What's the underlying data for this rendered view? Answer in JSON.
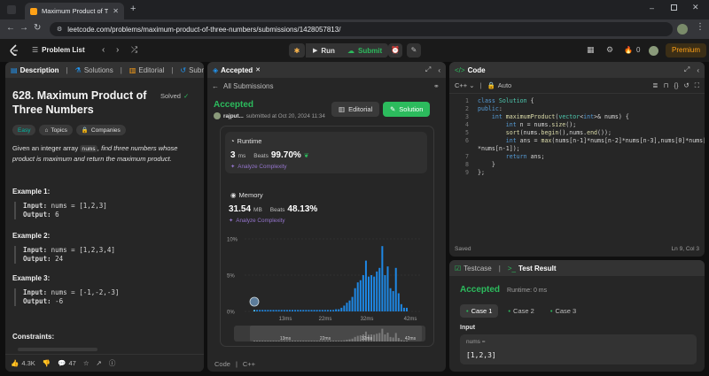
{
  "browser": {
    "tab_title": "Maximum Product of Three Nu",
    "url": "leetcode.com/problems/maximum-product-of-three-numbers/submissions/1428057813/"
  },
  "header": {
    "problem_list_label": "Problem List",
    "run_label": "Run",
    "submit_label": "Submit",
    "streak_count": "0",
    "premium_label": "Premium"
  },
  "left": {
    "tabs": [
      "Description",
      "Solutions",
      "Editorial",
      "Submissions"
    ],
    "title": "628. Maximum Product of Three Numbers",
    "solved_label": "Solved",
    "difficulty": "Easy",
    "topics_label": "Topics",
    "companies_label": "Companies",
    "desc_pre": "Given an integer array ",
    "desc_code": "nums",
    "desc_post": ", find three numbers whose product is maximum and return the maximum product.",
    "examples": [
      {
        "title": "Example 1:",
        "input": "nums = [1,2,3]",
        "output": "6"
      },
      {
        "title": "Example 2:",
        "input": "nums = [1,2,3,4]",
        "output": "24"
      },
      {
        "title": "Example 3:",
        "input": "nums = [-1,-2,-3]",
        "output": "-6"
      }
    ],
    "input_label": "Input:",
    "output_label": "Output:",
    "constraints_label": "Constraints:",
    "likes": "4.3K",
    "comments": "47"
  },
  "mid": {
    "tab_label": "Accepted",
    "back_label": "All Submissions",
    "status": "Accepted",
    "user": "rajput...",
    "submitted_text": "submitted at Oct 20, 2024 11:34",
    "editorial_label": "Editorial",
    "solution_label": "Solution",
    "runtime": {
      "title": "Runtime",
      "value": "3",
      "unit": "ms",
      "beats_label": "Beats",
      "beats": "99.70%",
      "analyze": "Analyze Complexity"
    },
    "memory": {
      "title": "Memory",
      "value": "31.54",
      "unit": "MB",
      "beats_label": "Beats",
      "beats": "48.13%",
      "analyze": "Analyze Complexity"
    },
    "footer_lang_label": "Code",
    "footer_lang": "C++"
  },
  "chart_data": {
    "type": "bar",
    "y_ticks": [
      "10%",
      "5%",
      "0%"
    ],
    "x_ticks": [
      "13ms",
      "22ms",
      "32ms",
      "42ms"
    ],
    "mini_x_ticks": [
      "13ms",
      "22ms",
      "32ms",
      "42ms"
    ],
    "ylim": [
      0,
      10
    ],
    "values": [
      0.2,
      0.2,
      0.2,
      0.2,
      0.2,
      0.2,
      0.2,
      0.2,
      0.2,
      0.2,
      0.2,
      0.2,
      0.2,
      0.2,
      0.2,
      0.2,
      0.2,
      0.2,
      0.2,
      0.2,
      0.2,
      0.2,
      0.2,
      0.2,
      0.2,
      0.2,
      0.2,
      0.2,
      0.2,
      0.2,
      0.3,
      0.3,
      0.5,
      0.8,
      1.2,
      1.5,
      2.0,
      3.2,
      4.0,
      4.3,
      5.0,
      7.0,
      4.8,
      5.0,
      4.8,
      5.5,
      6.0,
      9.0,
      5.0,
      6.2,
      3.2,
      2.8,
      6.0,
      2.5,
      1.0,
      0.5,
      0.5
    ],
    "highlight_index": 0,
    "colors": {
      "bar": "#1e88e5",
      "highlight": "#4fc3f7"
    }
  },
  "code": {
    "tab_label": "Code",
    "lang": "C++",
    "mode": "Auto",
    "lines": [
      {
        "n": "1",
        "t": "class Solution {"
      },
      {
        "n": "2",
        "t": "public:"
      },
      {
        "n": "3",
        "t": "    int maximumProduct(vector<int>& nums) {"
      },
      {
        "n": "4",
        "t": "        int n = nums.size();"
      },
      {
        "n": "5",
        "t": "        sort(nums.begin(),nums.end());"
      },
      {
        "n": "6",
        "t": "        int ans = max(nums[n-1]*nums[n-2]*nums[n-3],nums[0]*nums[1]"
      },
      {
        "n": "",
        "t": "*nums[n-1]);"
      },
      {
        "n": "7",
        "t": "        return ans;"
      },
      {
        "n": "8",
        "t": "    }"
      },
      {
        "n": "9",
        "t": "};"
      }
    ],
    "saved_label": "Saved",
    "cursor_pos": "Ln 9, Col 3"
  },
  "result": {
    "tabs": [
      "Testcase",
      "Test Result"
    ],
    "status": "Accepted",
    "runtime_text": "Runtime: 0 ms",
    "cases": [
      "Case 1",
      "Case 2",
      "Case 3"
    ],
    "input_label": "Input",
    "var_label": "nums =",
    "var_value": "[1,2,3]"
  },
  "colors": {
    "accent_green": "#2cbb5d",
    "easy": "#00b8a3",
    "premium": "#ffa116"
  }
}
